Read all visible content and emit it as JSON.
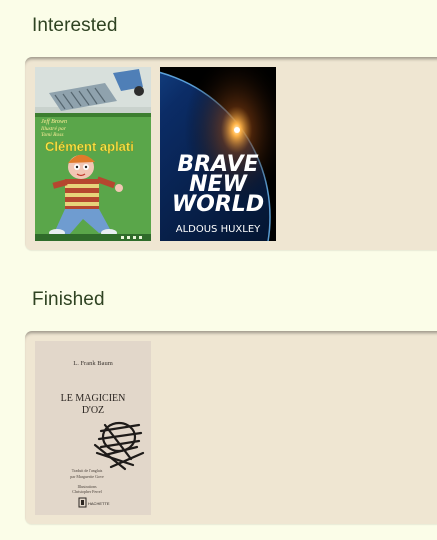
{
  "sections": [
    {
      "title": "Interested",
      "books": [
        {
          "author": "Jeff Brown",
          "illustrator_line": "Illustré par",
          "illustrator": "Tomi Ross",
          "title": "Clément aplati"
        },
        {
          "title_line1": "BRAVE",
          "title_line2": "NEW",
          "title_line3": "WORLD",
          "author": "ALDOUS HUXLEY"
        }
      ]
    },
    {
      "title": "Finished",
      "books": [
        {
          "author": "L. Frank Baum",
          "title_line1": "LE MAGICIEN",
          "title_line2": "D'OZ",
          "translator_line1": "Traduit de l'anglais",
          "translator_line2": "par Marguerite Gove",
          "illustrator_line1": "Illustrations",
          "illustrator_line2": "Christopher Ferrel",
          "publisher": "HACHETTE"
        }
      ]
    }
  ],
  "colors": {
    "page_bg": "#fbfde8",
    "shelf_bg": "#efe6d2",
    "heading": "#2f4322"
  }
}
